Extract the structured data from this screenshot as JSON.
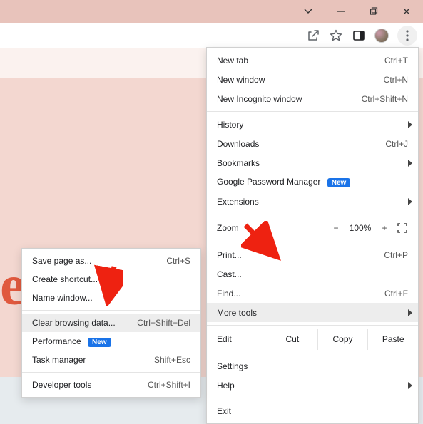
{
  "window_controls": {
    "minimize": "minimize",
    "maximize": "maximize",
    "close": "close",
    "dropdown": "tab-search"
  },
  "toolbar": {
    "share": "share",
    "bookmark": "bookmark-star",
    "side_panel": "side-panel",
    "profile": "profile-avatar",
    "menu": "customize-chrome"
  },
  "menu": {
    "new_tab": {
      "label": "New tab",
      "shortcut": "Ctrl+T"
    },
    "new_window": {
      "label": "New window",
      "shortcut": "Ctrl+N"
    },
    "new_incognito": {
      "label": "New Incognito window",
      "shortcut": "Ctrl+Shift+N"
    },
    "history": {
      "label": "History"
    },
    "downloads": {
      "label": "Downloads",
      "shortcut": "Ctrl+J"
    },
    "bookmarks": {
      "label": "Bookmarks"
    },
    "password_mgr": {
      "label": "Google Password Manager",
      "badge": "New"
    },
    "extensions": {
      "label": "Extensions"
    },
    "zoom": {
      "label": "Zoom",
      "minus": "−",
      "value": "100%",
      "plus": "+"
    },
    "print": {
      "label": "Print...",
      "shortcut": "Ctrl+P"
    },
    "cast": {
      "label": "Cast..."
    },
    "find": {
      "label": "Find...",
      "shortcut": "Ctrl+F"
    },
    "more_tools": {
      "label": "More tools"
    },
    "edit": {
      "label": "Edit",
      "cut": "Cut",
      "copy": "Copy",
      "paste": "Paste"
    },
    "settings": {
      "label": "Settings"
    },
    "help": {
      "label": "Help"
    },
    "exit": {
      "label": "Exit"
    }
  },
  "submenu": {
    "save_page": {
      "label": "Save page as...",
      "shortcut": "Ctrl+S"
    },
    "create_shortcut": {
      "label": "Create shortcut..."
    },
    "name_window": {
      "label": "Name window..."
    },
    "clear_browsing": {
      "label": "Clear browsing data...",
      "shortcut": "Ctrl+Shift+Del"
    },
    "performance": {
      "label": "Performance",
      "badge": "New"
    },
    "task_manager": {
      "label": "Task manager",
      "shortcut": "Shift+Esc"
    },
    "dev_tools": {
      "label": "Developer tools",
      "shortcut": "Ctrl+Shift+I"
    }
  },
  "page": {
    "glyph": "e"
  }
}
